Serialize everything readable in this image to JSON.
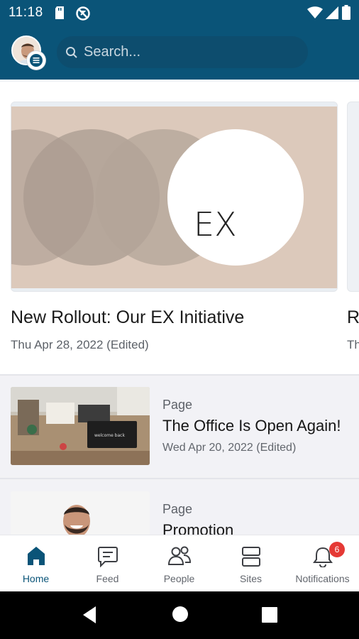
{
  "status": {
    "time": "11:18",
    "icons": [
      "sd-card-icon",
      "blocked-icon",
      "wifi-icon",
      "signal-icon",
      "battery-icon"
    ]
  },
  "header": {
    "search_placeholder": "Search..."
  },
  "featured": {
    "items": [
      {
        "title": "New Rollout: Our EX Initiative",
        "date": "Thu Apr 28, 2022 (Edited)",
        "image_text": "EX"
      },
      {
        "title": "R",
        "date": "Th"
      }
    ]
  },
  "list": {
    "items": [
      {
        "kind": "Page",
        "title": "The Office Is Open Again!",
        "date": "Wed Apr 20, 2022 (Edited)",
        "thumb_text": "welcome back"
      },
      {
        "kind": "Page",
        "title": "Promotion",
        "date": ""
      }
    ]
  },
  "nav": {
    "tabs": [
      {
        "label": "Home",
        "icon": "home-icon",
        "active": true
      },
      {
        "label": "Feed",
        "icon": "chat-icon",
        "active": false
      },
      {
        "label": "People",
        "icon": "people-icon",
        "active": false
      },
      {
        "label": "Sites",
        "icon": "sites-icon",
        "active": false
      },
      {
        "label": "Notifications",
        "icon": "bell-icon",
        "active": false,
        "badge": "6"
      }
    ]
  },
  "colors": {
    "brand": "#0a5478",
    "badge": "#e53935"
  }
}
